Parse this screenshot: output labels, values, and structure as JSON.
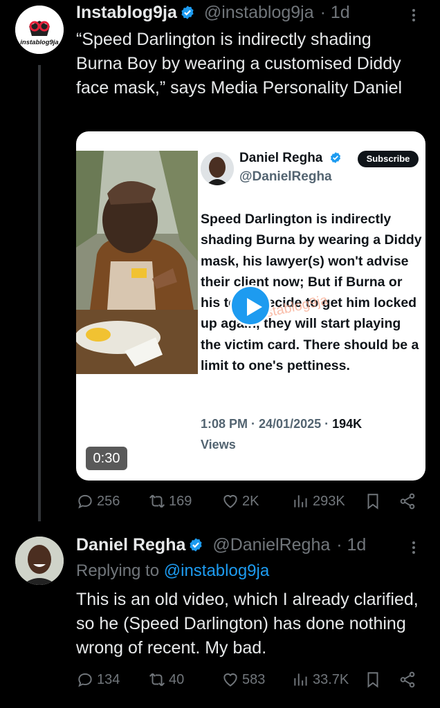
{
  "post": {
    "author_name": "Instablog9ja",
    "author_handle": "@instablog9ja",
    "time": "· 1d",
    "avatar_text": "instablog9ja",
    "text": "“Speed Darlington is indirectly shading Burna Boy by wearing a customised Diddy face mask,” says Media Personality Daniel",
    "media": {
      "card_name": "Daniel Regha",
      "card_handle": "@DanielRegha",
      "subscribe_label": "Subscribe",
      "card_text": "Speed Darlington is indirectly shading Burna by wearing a Diddy mask, his lawyer(s) won't advise their client now; But if Burna or his team decide to get him locked up again, they will start playing the victim card. There should be a limit to one's pettiness.",
      "card_time": "1:08 PM · 24/01/2025 ·",
      "card_views_count": "194K",
      "card_views_label": "Views",
      "watermark": "instablog9ja",
      "duration": "0:30"
    },
    "actions": {
      "replies": "256",
      "reposts": "169",
      "likes": "2K",
      "views": "293K"
    }
  },
  "reply": {
    "author_name": "Daniel Regha",
    "author_handle": "@DanielRegha",
    "time": "· 1d",
    "replying_prefix": "Replying to",
    "replying_handle": "@instablog9ja",
    "text": "This is an old video, which I already clarified, so he (Speed Darlington) has done nothing wrong of recent. My bad.",
    "actions": {
      "replies": "134",
      "reposts": "40",
      "likes": "583",
      "views": "33.7K"
    }
  },
  "colors": {
    "background": "#000000",
    "text": "#e7e9ea",
    "muted": "#71767b",
    "accent": "#1d9bf0"
  }
}
